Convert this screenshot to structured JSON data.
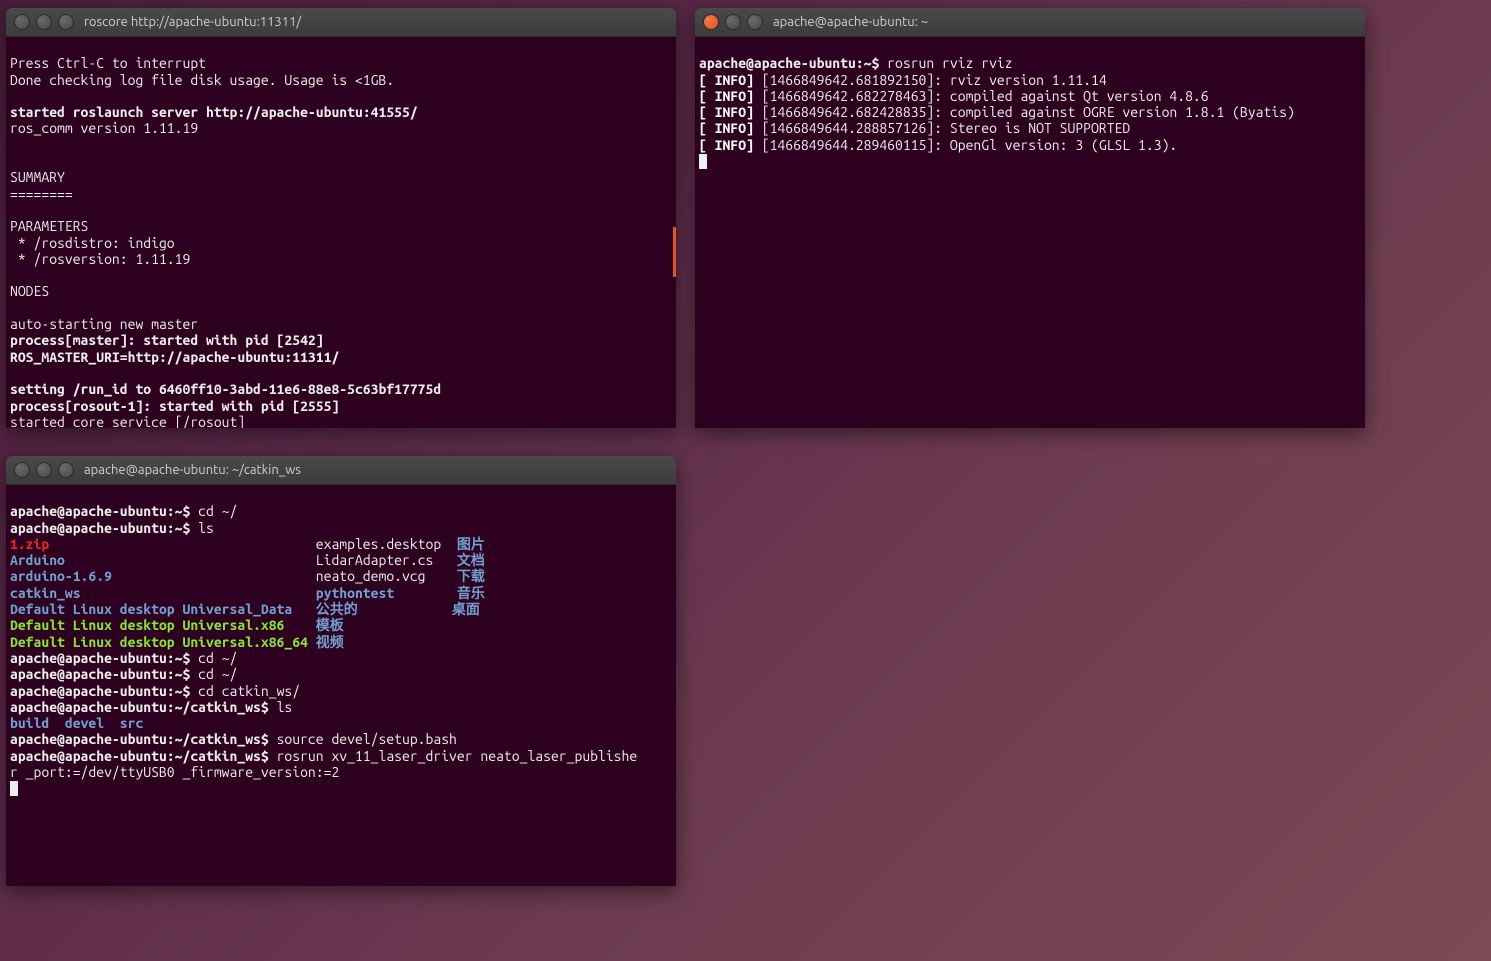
{
  "term1": {
    "title": "roscore http://apache-ubuntu:11311/",
    "lines": {
      "l1": "Press Ctrl-C to interrupt",
      "l2": "Done checking log file disk usage. Usage is <1GB.",
      "l3": "",
      "l4": "started roslaunch server http://apache-ubuntu:41555/",
      "l5": "ros_comm version 1.11.19",
      "l6": "",
      "l7": "",
      "l8": "SUMMARY",
      "l9": "========",
      "l10": "",
      "l11": "PARAMETERS",
      "l12": " * /rosdistro: indigo",
      "l13": " * /rosversion: 1.11.19",
      "l14": "",
      "l15": "NODES",
      "l16": "",
      "l17": "auto-starting new master",
      "l18": "process[master]: started with pid [2542]",
      "l19": "ROS_MASTER_URI=http://apache-ubuntu:11311/",
      "l20": "",
      "l21": "setting /run_id to 6460ff10-3abd-11e6-88e8-5c63bf17775d",
      "l22": "process[rosout-1]: started with pid [2555]",
      "l23": "started core service [/rosout]"
    }
  },
  "term2": {
    "title": "apache@apache-ubuntu: ~",
    "prompt": "apache@apache-ubuntu:~$ ",
    "cmd": "rosrun rviz rviz",
    "info_label": "[ INFO]",
    "lines": {
      "l1": " [1466849642.681892150]: rviz version 1.11.14",
      "l2": " [1466849642.682278463]: compiled against Qt version 4.8.6",
      "l3": " [1466849642.682428835]: compiled against OGRE version 1.8.1 (Byatis)",
      "l4": " [1466849644.288857126]: Stereo is NOT SUPPORTED",
      "l5": " [1466849644.289460115]: OpenGl version: 3 (GLSL 1.3)."
    }
  },
  "term3": {
    "title": "apache@apache-ubuntu: ~/catkin_ws",
    "prompt_home": "apache@apache-ubuntu:~$ ",
    "prompt_ws": "apache@apache-ubuntu:~/catkin_ws$ ",
    "cmd1": "cd ~/",
    "cmd2": "ls",
    "ls": {
      "r1c1": "1.zip",
      "r1c2": "examples.desktop",
      "r1c3": "图片",
      "r2c1": "Arduino",
      "r2c2": "LidarAdapter.cs",
      "r2c3": "文档",
      "r3c1": "arduino-1.6.9",
      "r3c2": "neato_demo.vcg",
      "r3c3": "下载",
      "r4c1": "catkin_ws",
      "r4c2": "pythontest",
      "r4c3": "音乐",
      "r5c1": "Default Linux desktop Universal_Data",
      "r5c2": "公共的",
      "r5c3": "桌面",
      "r6c1": "Default Linux desktop Universal.x86",
      "r6c2": "模板",
      "r7c1": "Default Linux desktop Universal.x86_64",
      "r7c2": "视频"
    },
    "cmd3": "cd ~/",
    "cmd4": "cd ~/",
    "cmd5": "cd catkin_ws/",
    "cmd6": "ls",
    "ls2": {
      "c1": "build",
      "c2": "devel",
      "c3": "src"
    },
    "cmd7": "source devel/setup.bash",
    "cmd8a": "rosrun xv_11_laser_driver neato_laser_publishe",
    "cmd8b": "r _port:=/dev/ttyUSB0 _firmware_version:=2"
  }
}
